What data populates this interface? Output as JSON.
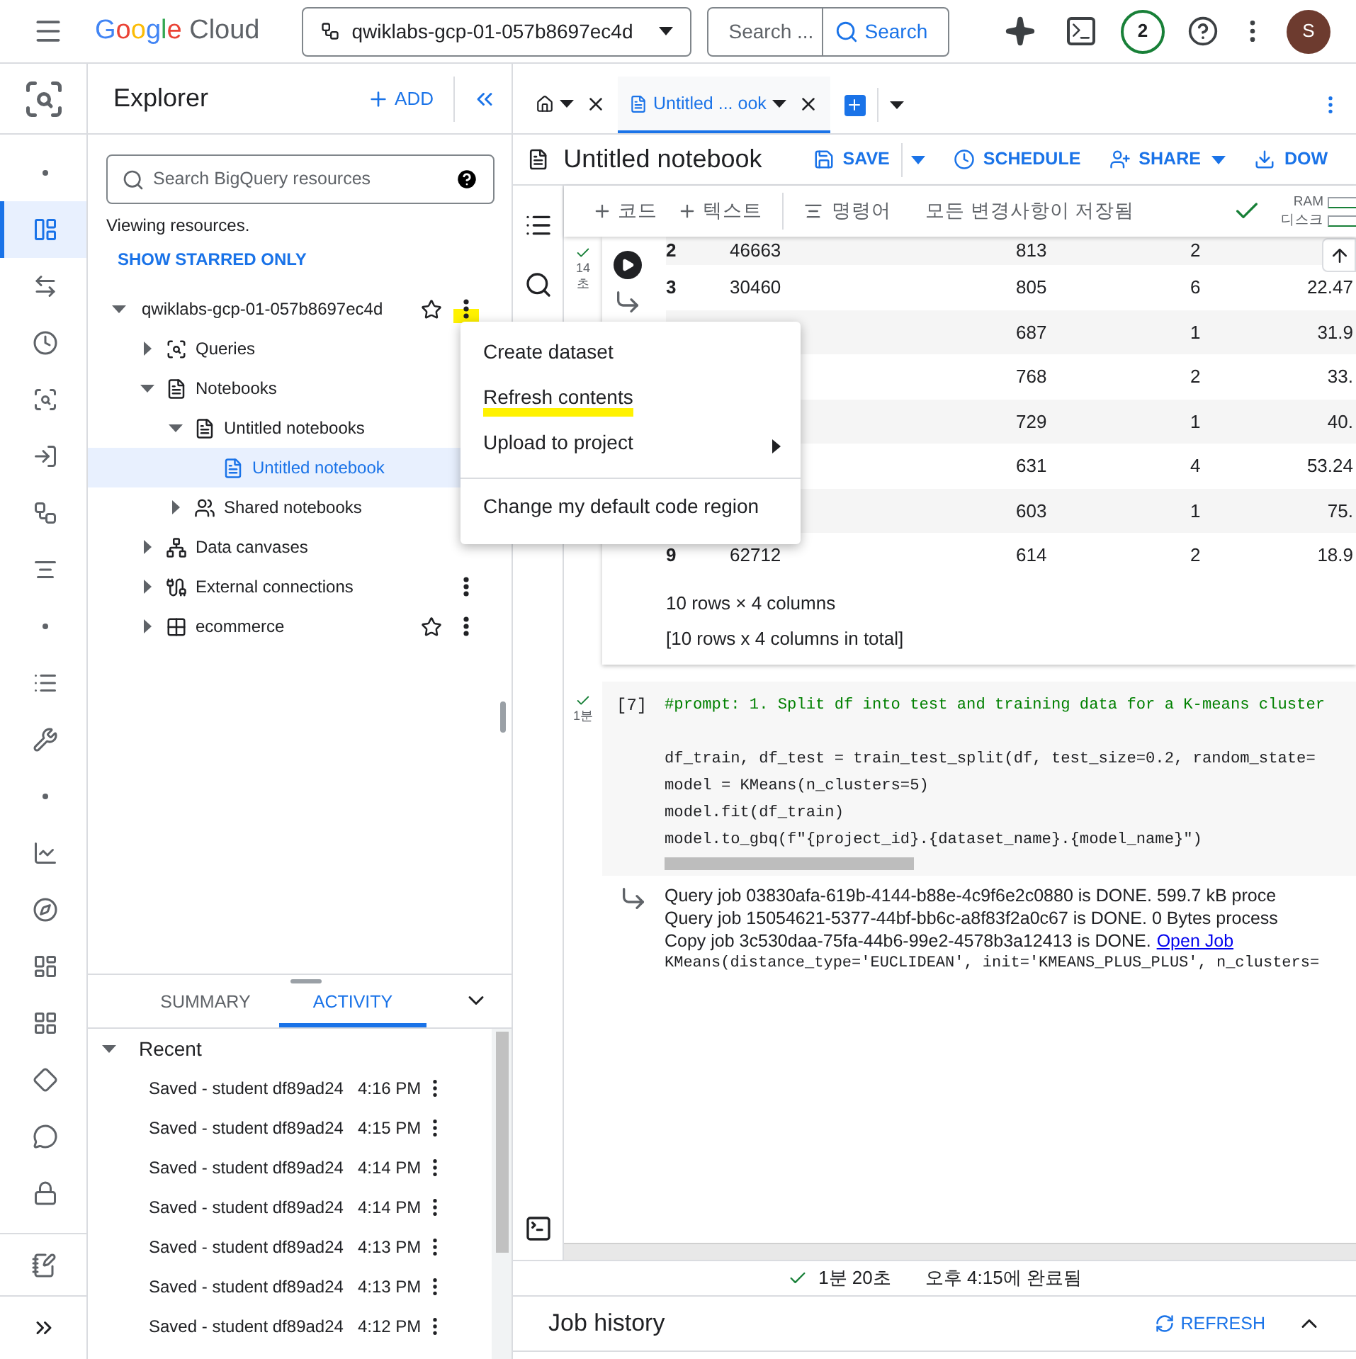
{
  "topbar": {
    "brand": "Google",
    "product": "Cloud",
    "project": "qwiklabs-gcp-01-057b8697ec4d",
    "search_placeholder": "Search ...",
    "search_button": "Search",
    "notifications": "2",
    "avatar": "S"
  },
  "rail": [
    {
      "kind": "dot",
      "selected": false
    },
    {
      "kind": "studio",
      "selected": true
    },
    {
      "kind": "transfer",
      "selected": false
    },
    {
      "kind": "scheduled",
      "selected": false
    },
    {
      "kind": "analytics",
      "selected": false
    },
    {
      "kind": "pipeline",
      "selected": false
    },
    {
      "kind": "graph",
      "selected": false
    },
    {
      "kind": "details",
      "selected": false
    },
    {
      "kind": "dot",
      "selected": false
    },
    {
      "kind": "list",
      "selected": false
    },
    {
      "kind": "wrench",
      "selected": false
    },
    {
      "kind": "dot",
      "selected": false
    },
    {
      "kind": "chart",
      "selected": false
    },
    {
      "kind": "compass",
      "selected": false
    },
    {
      "kind": "dashboard",
      "selected": false
    },
    {
      "kind": "table",
      "selected": false
    },
    {
      "kind": "diamond",
      "selected": false
    },
    {
      "kind": "chat",
      "selected": false
    },
    {
      "kind": "lock",
      "selected": false
    }
  ],
  "explorer": {
    "title": "Explorer",
    "add": "ADD",
    "search_placeholder": "Search BigQuery resources",
    "status": "Viewing resources.",
    "starred_link": "SHOW STARRED ONLY",
    "tree": [
      {
        "label": "qwiklabs-gcp-01-057b8697ec4d",
        "expanded": true,
        "selected": false,
        "star_button": true,
        "more_button": true,
        "more_highlighted": true,
        "children": [
          {
            "label": "Queries",
            "kind": "queries",
            "expanded": false,
            "selected": false
          },
          {
            "label": "Notebooks",
            "kind": "notebook",
            "expanded": true,
            "selected": false,
            "children": [
              {
                "label": "Untitled notebooks",
                "kind": "notebook",
                "expanded": true,
                "selected": false,
                "children": [
                  {
                    "label": "Untitled notebook",
                    "kind": "notebook",
                    "selected": true
                  }
                ]
              },
              {
                "label": "Shared notebooks",
                "kind": "shared",
                "expanded": false,
                "selected": false
              }
            ]
          },
          {
            "label": "Data canvases",
            "kind": "canvas",
            "expanded": false,
            "selected": false
          },
          {
            "label": "External connections",
            "kind": "connection",
            "expanded": false,
            "selected": false,
            "more_button": true
          },
          {
            "label": "ecommerce",
            "kind": "dataset",
            "expanded": false,
            "selected": false,
            "star_button": true,
            "more_button": true
          }
        ]
      }
    ],
    "panel_tabs": [
      {
        "label": "SUMMARY",
        "selected": false
      },
      {
        "label": "ACTIVITY",
        "selected": true
      }
    ],
    "recent": {
      "label": "Recent",
      "expanded": true,
      "items": [
        {
          "text": "Saved - student df89ad24",
          "time": "4:16 PM"
        },
        {
          "text": "Saved - student df89ad24",
          "time": "4:15 PM"
        },
        {
          "text": "Saved - student df89ad24",
          "time": "4:14 PM"
        },
        {
          "text": "Saved - student df89ad24",
          "time": "4:14 PM"
        },
        {
          "text": "Saved - student df89ad24",
          "time": "4:13 PM"
        },
        {
          "text": "Saved - student df89ad24",
          "time": "4:13 PM"
        },
        {
          "text": "Saved - student df89ad24",
          "time": "4:12 PM"
        }
      ]
    }
  },
  "context_menu": {
    "groups": [
      [
        {
          "label": "Create dataset",
          "highlighted": false,
          "submenu": false
        },
        {
          "label": "Refresh contents",
          "highlighted": true,
          "submenu": false
        },
        {
          "label": "Upload to project",
          "highlighted": false,
          "submenu": true
        }
      ],
      [
        {
          "label": "Change my default code region",
          "highlighted": false,
          "submenu": false
        }
      ]
    ]
  },
  "editor_tabs": [
    {
      "kind": "home",
      "selected": false
    },
    {
      "kind": "notebook",
      "label": "Untitled ...  ook",
      "selected": true
    }
  ],
  "notebook": {
    "title": "Untitled notebook",
    "actions": [
      {
        "kind": "save",
        "label": "SAVE",
        "caret": true
      },
      {
        "kind": "schedule",
        "label": "SCHEDULE",
        "caret": false
      },
      {
        "kind": "share",
        "label": "SHARE",
        "caret": true
      },
      {
        "kind": "download",
        "label": "DOW",
        "caret": false
      }
    ],
    "toolbar": {
      "add_code": "코드",
      "add_text": "텍스트",
      "commands": "명령어",
      "save_status": "모든 변경사항이 저장됨",
      "ram": "RAM",
      "disk": "디스크"
    },
    "cells": [
      {
        "kind": "output",
        "status": "14",
        "status_unit": "초",
        "rows": [
          {
            "index": "2",
            "column_2": "46663",
            "column_3": "813",
            "column_4": "2"
          },
          {
            "index": "3",
            "column_2": "30460",
            "column_3": "805",
            "column_4": "6",
            "column_5": "22.47"
          },
          {
            "column_3": "687",
            "column_4": "1",
            "column_5": "31.9"
          },
          {
            "column_3": "768",
            "column_4": "2",
            "column_5": "33."
          },
          {
            "column_3": "729",
            "column_4": "1",
            "column_5": "40."
          },
          {
            "column_3": "631",
            "column_4": "4",
            "column_5": "53.24"
          },
          {
            "column_3": "603",
            "column_4": "1",
            "column_5": "75."
          },
          {
            "index": "9",
            "column_2": "62712",
            "column_3": "614",
            "column_4": "2",
            "column_5": "18.9"
          }
        ],
        "summary": [
          "10 rows × 4 columns",
          "[10 rows x 4 columns in total]"
        ]
      },
      {
        "kind": "code",
        "count": "[7]",
        "status": "1분",
        "code": [
          {
            "kind": "comment",
            "text": "#prompt: 1. Split df into test and training data for a K-means cluster"
          },
          {
            "kind": "blank"
          },
          {
            "kind": "code",
            "text": "df_train, df_test = train_test_split(df, test_size=0.2,  random_state="
          },
          {
            "kind": "code",
            "text": "model = KMeans(n_clusters=5)"
          },
          {
            "kind": "code",
            "text": "model.fit(df_train)"
          },
          {
            "kind": "code",
            "text": "model.to_gbq(f\"{project_id}.{dataset_name}.{model_name}\")"
          }
        ],
        "output": [
          {
            "text": "Query job 03830afa-619b-4144-b88e-4c9f6e2c0880 is DONE. 599.7 kB proce"
          },
          {
            "text": "Query job 15054621-5377-44bf-bb6c-a8f83f2a0c67 is DONE. 0 Bytes process"
          },
          {
            "text": "Copy job 3c530daa-75fa-44b6-99e2-4578b3a12413 is DONE.",
            "link": "Open Job"
          },
          {
            "text": "KMeans(distance_type='EUCLIDEAN', init='KMEANS_PLUS_PLUS', n_clusters=",
            "kind": "mono"
          }
        ]
      }
    ],
    "duration": "1분 20초",
    "completed": "오후 4:15에 완료됨"
  },
  "job_history": {
    "title": "Job history",
    "refresh": "REFRESH"
  }
}
